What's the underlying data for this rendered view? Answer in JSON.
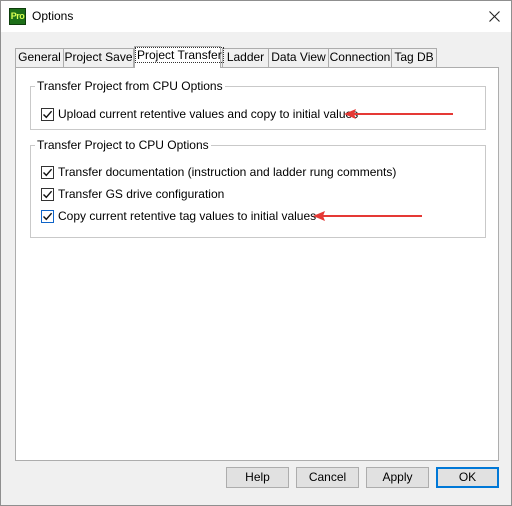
{
  "window": {
    "title": "Options",
    "app_icon_text": "Pro"
  },
  "tabs": [
    {
      "label": "General",
      "active": false
    },
    {
      "label": "Project Save",
      "active": false
    },
    {
      "label": "Project Transfer",
      "active": true
    },
    {
      "label": "Ladder",
      "active": false
    },
    {
      "label": "Data View",
      "active": false
    },
    {
      "label": "Connection",
      "active": false
    },
    {
      "label": "Tag DB",
      "active": false
    }
  ],
  "groups": {
    "from_cpu": {
      "title": "Transfer Project from CPU Options",
      "items": [
        {
          "label": "Upload current retentive values and copy to initial values",
          "checked": true
        }
      ]
    },
    "to_cpu": {
      "title": "Transfer Project to CPU Options",
      "items": [
        {
          "label": "Transfer documentation (instruction and ladder rung comments)",
          "checked": true
        },
        {
          "label": "Transfer GS drive configuration",
          "checked": true
        },
        {
          "label": "Copy current retentive tag values to initial values",
          "checked": true
        }
      ]
    }
  },
  "buttons": {
    "help": "Help",
    "cancel": "Cancel",
    "apply": "Apply",
    "ok": "OK"
  },
  "colors": {
    "annotation_arrow": "#e53935",
    "focus_blue": "#0078d7",
    "app_icon_green": "#1d6f18"
  }
}
